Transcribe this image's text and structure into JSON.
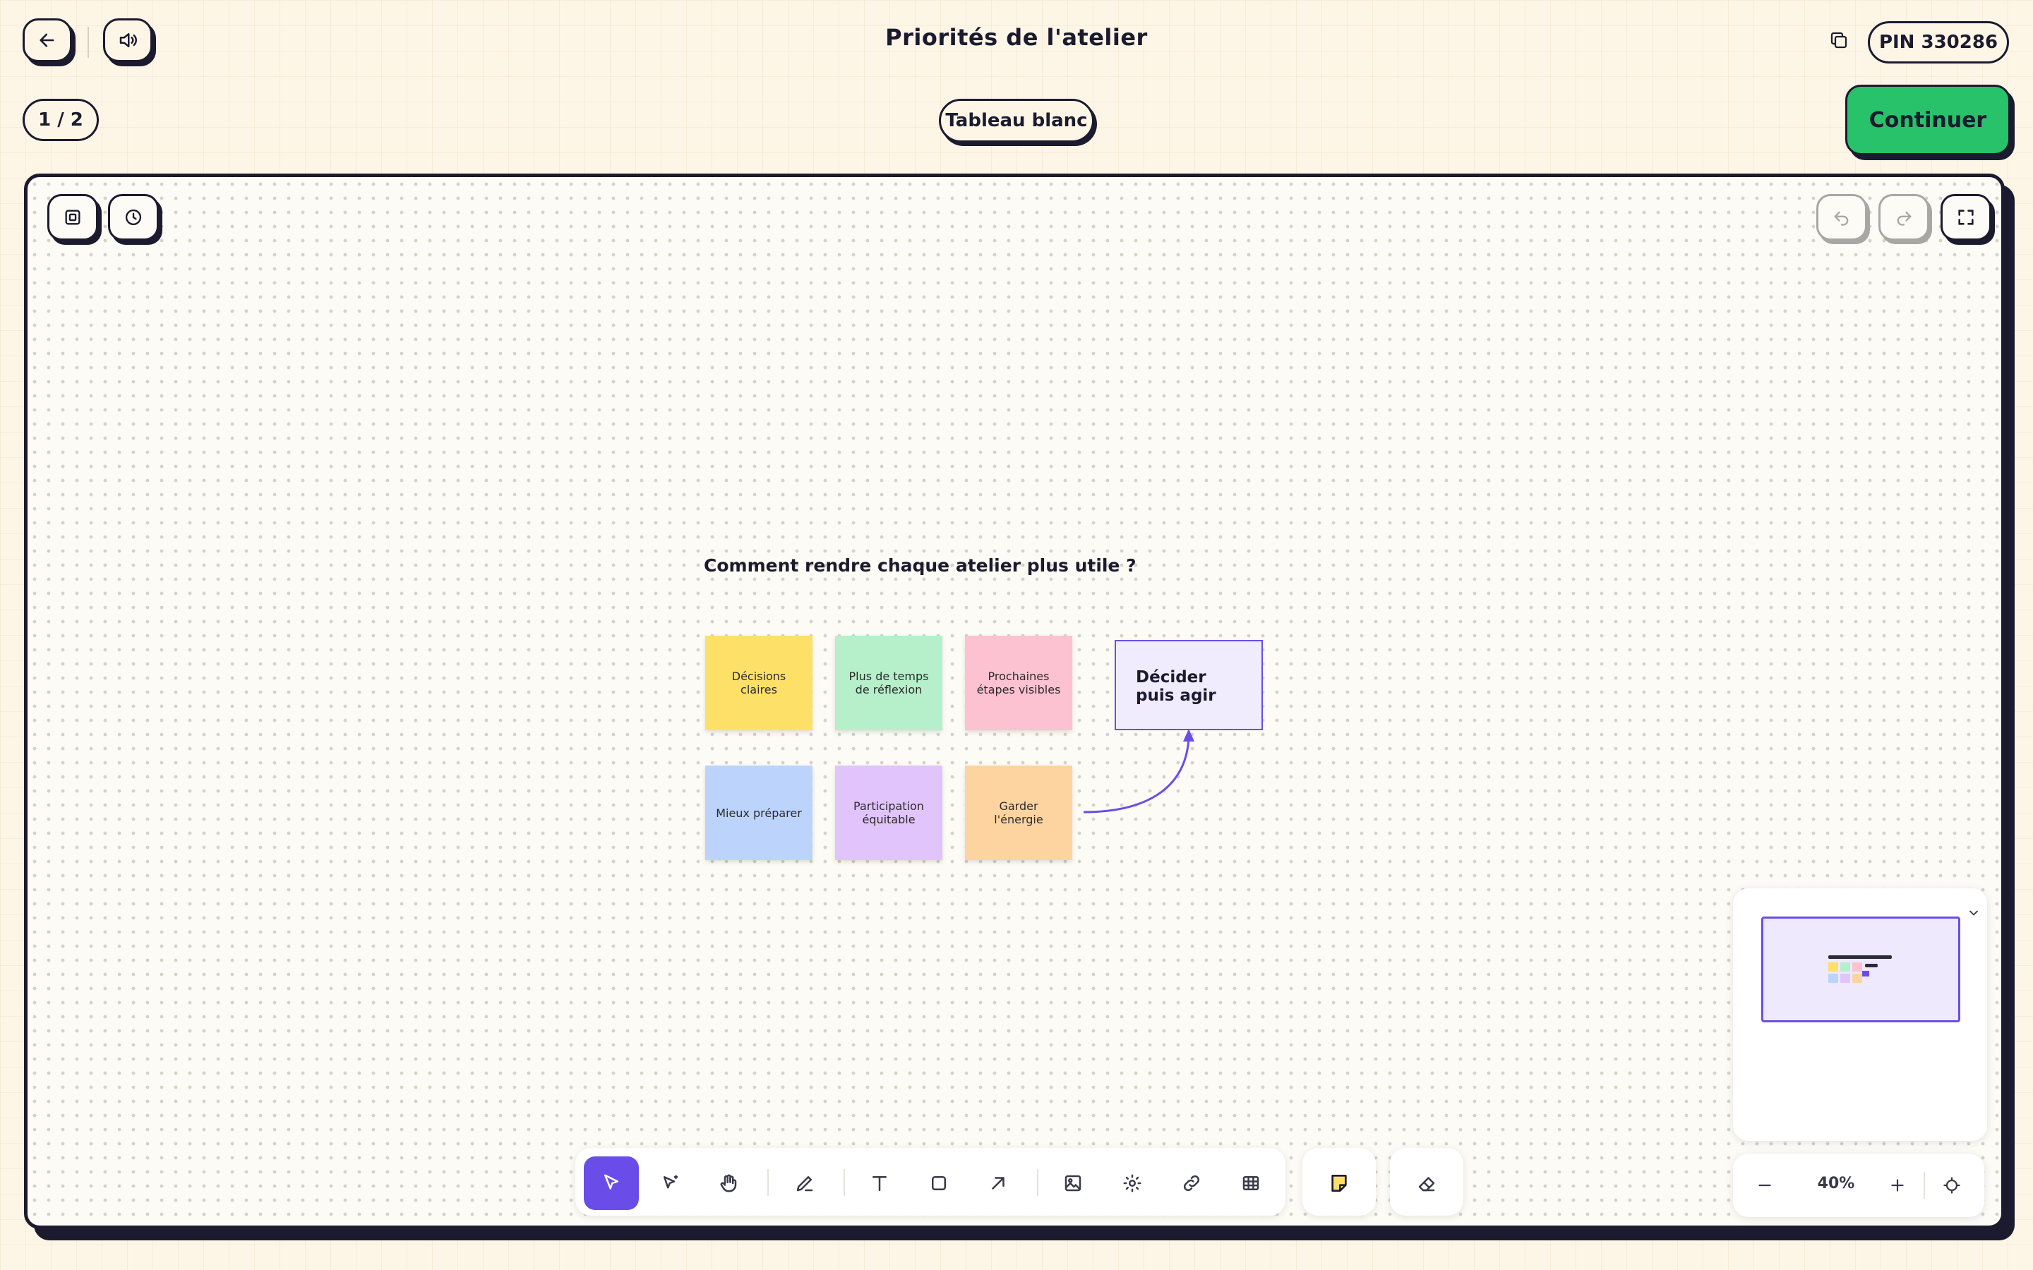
{
  "header": {
    "title": "Priorités de l'atelier",
    "page_counter": "1 / 2",
    "pin": "PIN 330286",
    "mode_label": "Tableau blanc",
    "continue_label": "Continuer"
  },
  "colors": {
    "accent": "#6a4de8",
    "continue_green": "#27c26a",
    "ink": "#1b1a2e",
    "page_bg": "#fdf6e7"
  },
  "board": {
    "heading": "Comment rendre chaque atelier plus utile ?",
    "notes": [
      {
        "label": "Décisions claires",
        "color": "#fde068"
      },
      {
        "label": "Plus de temps de réflexion",
        "color": "#b5f0ca"
      },
      {
        "label": "Prochaines étapes visibles",
        "color": "#fcc2d2"
      },
      {
        "label": "Mieux préparer",
        "color": "#bcd4fb"
      },
      {
        "label": "Participation équitable",
        "color": "#e1c4fb"
      },
      {
        "label": "Garder l'énergie",
        "color": "#fdd4a0"
      }
    ],
    "box_label": "Décider puis agir"
  },
  "zoom": {
    "level": "40%"
  },
  "icons": {
    "back": "arrow-left-icon",
    "audio": "speaker-icon",
    "copy": "copy-icon",
    "frame": "frame-icon",
    "timer": "clock-icon",
    "undo": "undo-icon",
    "redo": "redo-icon",
    "fullscreen": "fullscreen-icon",
    "tools": [
      "select-icon",
      "magic-select-icon",
      "hand-icon",
      "pen-icon",
      "text-icon",
      "rectangle-icon",
      "arrow-icon",
      "image-icon",
      "sparkle-icon",
      "link-icon",
      "table-icon",
      "sticky-note-icon",
      "eraser-icon"
    ],
    "minimap_toggle": "chevron-down-icon",
    "zoom_out": "minus-icon",
    "zoom_in": "plus-icon",
    "recenter": "crosshair-icon"
  }
}
